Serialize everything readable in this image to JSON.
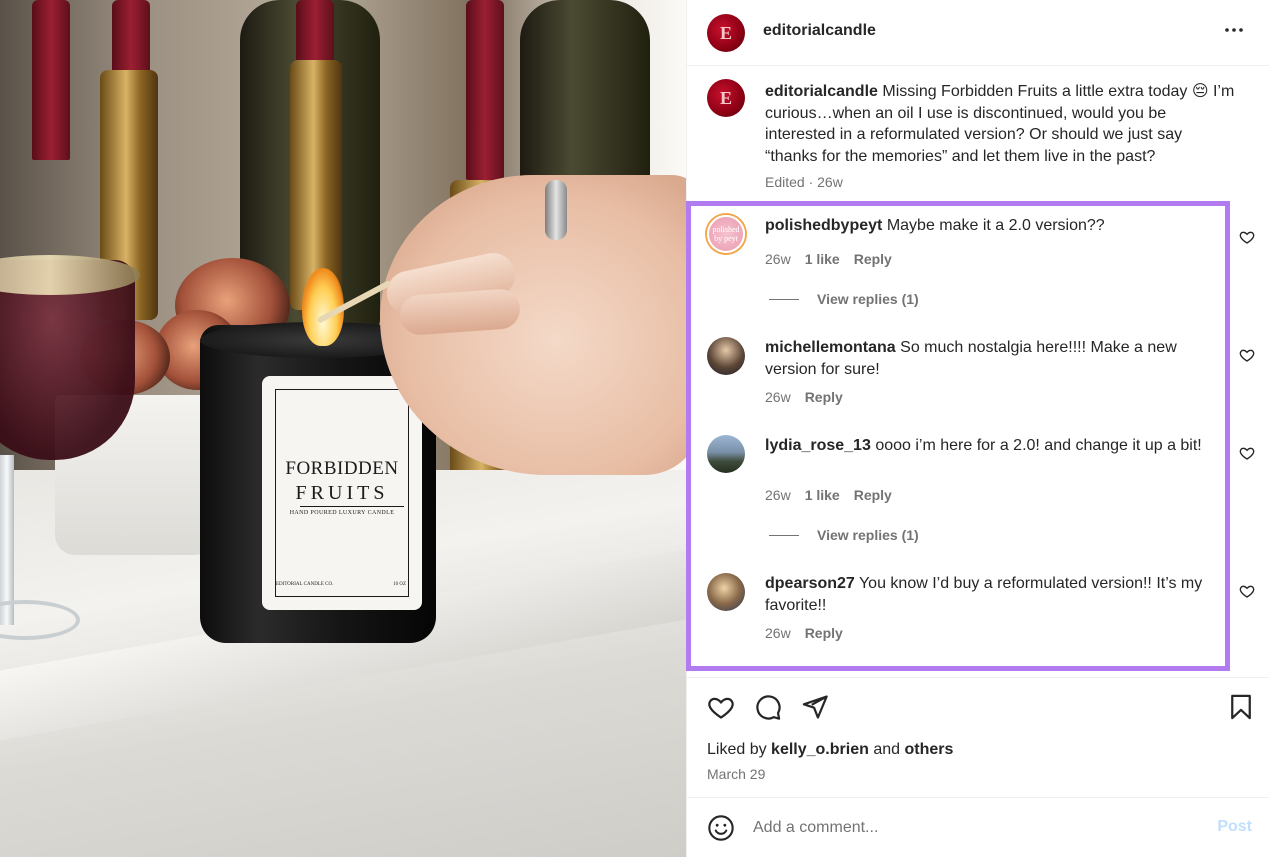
{
  "post": {
    "username": "editorialcandle",
    "avatar_letter": "E",
    "more_icon": "more-horizontal-icon",
    "caption": {
      "username": "editorialcandle",
      "text": "Missing Forbidden Fruits a little extra today 😔 I’m curious…when an oil I use is discontinued, would you be interested in a reformulated version? Or should we just say “thanks for the memories” and let them live in the past?",
      "meta": "Edited · 26w"
    },
    "photo": {
      "label_line1": "FORBIDDEN",
      "label_line2": "FRUITS",
      "label_line3": "HAND POURED LUXURY CANDLE",
      "label_brand": "EDITORIAL CANDLE CO.",
      "label_size": "10 OZ"
    }
  },
  "comments": [
    {
      "username": "polishedbypeyt",
      "avatar_text": "polished by peyt",
      "text": "Maybe make it a 2.0 version??",
      "time": "26w",
      "likes": "1 like",
      "reply": "Reply",
      "view_replies": "View replies (1)"
    },
    {
      "username": "michellemontana",
      "text": "So much nostalgia here!!!! Make a new version for sure!",
      "time": "26w",
      "reply": "Reply"
    },
    {
      "username": "lydia_rose_13",
      "text": "oooo i’m here for a 2.0! and change it up a bit!",
      "time": "26w",
      "likes": "1 like",
      "reply": "Reply",
      "view_replies": "View replies (1)"
    },
    {
      "username": "dpearson27",
      "text": "You know I’d buy a reformulated version!! It’s my favorite!!",
      "time": "26w",
      "reply": "Reply"
    }
  ],
  "actions": {
    "like_icon": "heart-icon",
    "comment_icon": "comment-icon",
    "share_icon": "send-icon",
    "save_icon": "bookmark-icon"
  },
  "likes": {
    "prefix": "Liked by",
    "user": "kelly_o.brien",
    "joiner": "and",
    "suffix": "others"
  },
  "date": "March 29",
  "composer": {
    "placeholder": "Add a comment...",
    "post_label": "Post"
  },
  "colors": {
    "highlight": "#b37bf2",
    "post_disabled": "#c0dffd",
    "secondary_text": "#737373"
  }
}
